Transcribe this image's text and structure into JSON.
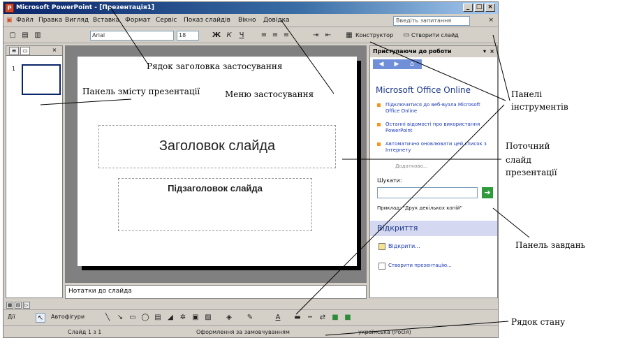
{
  "window": {
    "title": "Microsoft PowerPoint - [Презентація1]"
  },
  "menu": {
    "items": [
      "Файл",
      "Правка",
      "Вигляд",
      "Вставка",
      "Формат",
      "Сервіс",
      "Показ слайдів",
      "Вікно",
      "Довідка"
    ],
    "help_placeholder": "Введіть запитання"
  },
  "toolbar": {
    "font_name": "Arial",
    "font_size": "18",
    "bold": "Ж",
    "italic": "К",
    "underline": "Ч",
    "designer": "Конструктор",
    "new_slide": "Створити слайд"
  },
  "slide": {
    "thumb_number": "1",
    "title_placeholder": "Заголовок слайда",
    "subtitle_placeholder": "Підзаголовок слайда",
    "notes": "Нотатки до слайда"
  },
  "task_pane": {
    "header": "Приступаючи до роботи",
    "office_online": "Microsoft Office Online",
    "links": [
      "Підключитися до веб-вузла Microsoft Office Online",
      "Останні відомості про використання PowerPoint",
      "Автоматично оновлювати цей список з Інтернету"
    ],
    "more": "Додатково...",
    "search_label": "Шукати:",
    "search_example": "Приклад: \"Друк декількох копій\"",
    "open_header": "Відкриття",
    "open_link": "Відкрити...",
    "create_link": "Створити презентацію..."
  },
  "drawing_toolbar": {
    "draw_label": "Дії",
    "autoshapes_label": "Автофігури"
  },
  "status": {
    "slide": "Слайд 1 з 1",
    "design": "Оформлення за замовчуванням",
    "language": "українська (Росія)"
  },
  "callouts": {
    "title_bar": "Рядок заголовка застосування",
    "content_pane": "Панель змісту презентації",
    "menu": "Меню застосування",
    "toolbars": [
      "Панелі",
      "інструментів"
    ],
    "current_slide": [
      "Поточний",
      "слайд",
      "презентації"
    ],
    "task_pane": "Панель завдань",
    "status_bar": "Рядок стану"
  },
  "icons": {
    "app": "powerpoint-app-icon",
    "minimize": "minimize-icon",
    "maximize": "maximize-icon",
    "close": "close-icon",
    "go": "go-arrow-icon"
  }
}
